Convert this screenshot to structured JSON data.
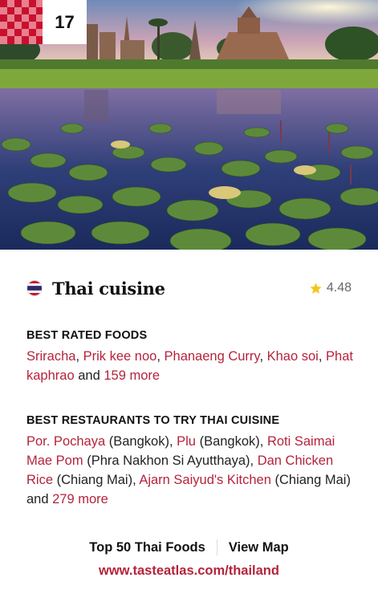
{
  "rank": "17",
  "title": "Thai cuisine",
  "rating": "4.48",
  "best_rated": {
    "heading": "BEST RATED FOODS",
    "foods": [
      "Sriracha",
      "Prik kee noo",
      "Phanaeng Curry",
      "Khao soi",
      "Phat kaphrao"
    ],
    "and_text": "and",
    "more_text": "159 more"
  },
  "restaurants": {
    "heading": "BEST RESTAURANTS TO TRY THAI CUISINE",
    "items": [
      {
        "name": "Por. Pochaya",
        "place": "(Bangkok)"
      },
      {
        "name": "Plu",
        "place": "(Bangkok)"
      },
      {
        "name": "Roti Saimai Mae Pom",
        "place": "(Phra Nakhon Si Ayutthaya)"
      },
      {
        "name": "Dan Chicken Rice",
        "place": "(Chiang Mai)"
      },
      {
        "name": "Ajarn Saiyud's Kitchen",
        "place": "(Chiang Mai)"
      }
    ],
    "and_text": "and",
    "more_text": "279 more"
  },
  "links": {
    "top50": "Top 50 Thai Foods",
    "map": "View Map",
    "url": "www.tasteatlas.com/thailand"
  },
  "colors": {
    "accent": "#b5233c",
    "badge_red": "#c8102e",
    "star": "#f5c518"
  },
  "icons": {
    "flag": "thailand-flag-icon",
    "star": "star-icon"
  }
}
